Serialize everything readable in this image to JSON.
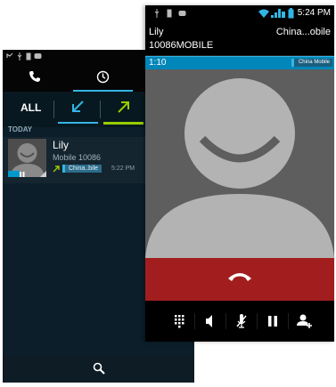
{
  "call_log_phone": {
    "tabs": [
      {
        "name": "phone",
        "icon": "phone-icon"
      },
      {
        "name": "recent",
        "icon": "clock-icon",
        "selected": true
      }
    ],
    "filters": {
      "all_label": "ALL",
      "incoming_icon": "incoming-arrow-icon",
      "outgoing_icon": "outgoing-arrow-icon",
      "selected": "outgoing"
    },
    "section_label": "TODAY",
    "entries": [
      {
        "name": "Lily",
        "number": "Mobile 10086",
        "sim": "China..bile",
        "time": "5:22 PM",
        "direction": "outgoing"
      }
    ],
    "bottom_icon": "search-icon"
  },
  "in_call_phone": {
    "status_time": "5:24 PM",
    "caller_name": "Lily",
    "caller_number": "10086MOBILE",
    "operator": "China...obile",
    "call_timer": "1:10",
    "sim_label": "China Mobile",
    "end_call_icon": "end-call-icon",
    "controls": [
      "dialpad-icon",
      "speaker-icon",
      "mute-icon",
      "hold-icon",
      "add-call-icon"
    ],
    "colors": {
      "accent": "#33b5e5",
      "end_call": "#a21e1e",
      "outgoing": "#99cc00"
    }
  }
}
